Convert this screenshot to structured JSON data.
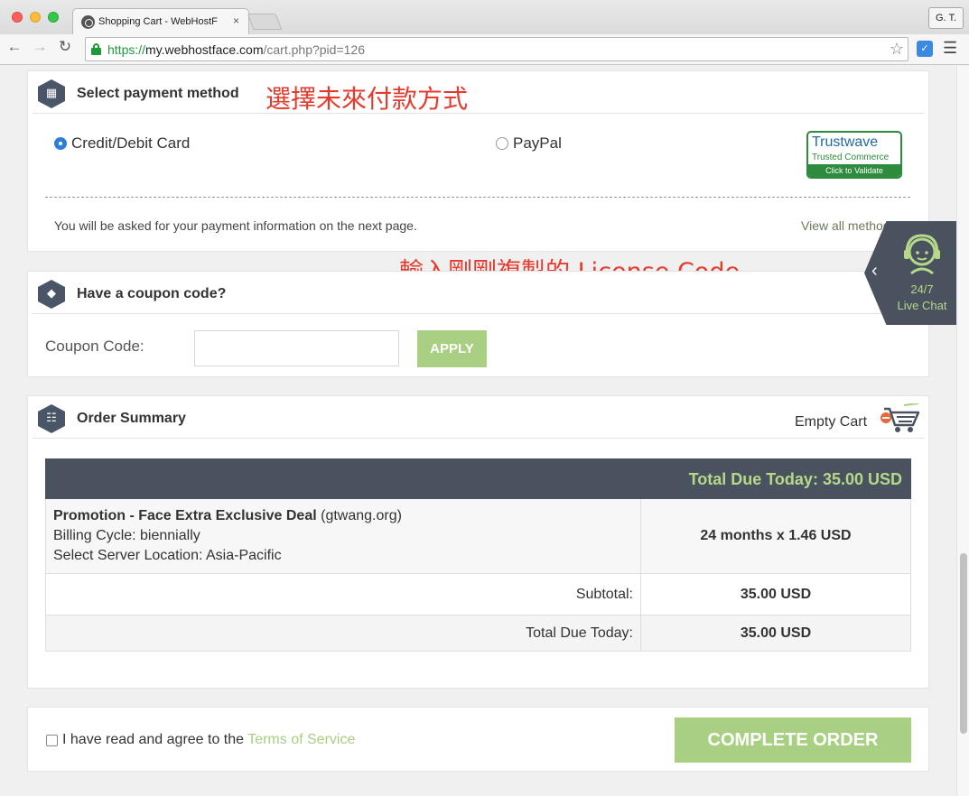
{
  "browser": {
    "tab_title": "Shopping Cart - WebHostF",
    "tab_close": "×",
    "profile": "G. T.",
    "url_scheme": "https://",
    "url_host": "my.webhostface.com",
    "url_path": "/cart.php?pid=126",
    "icons": [
      "back-icon",
      "forward-icon",
      "reload-icon",
      "lock-icon",
      "star-icon",
      "extension-icon",
      "menu-icon"
    ]
  },
  "payment": {
    "title": "Select payment method",
    "annotation": "選擇未來付款方式",
    "options": [
      {
        "label": "Credit/Debit Card",
        "selected": true
      },
      {
        "label": "PayPal",
        "selected": false
      }
    ],
    "badge": {
      "name": "Trustwave",
      "sub": "Trusted Commerce",
      "validate": "Click to Validate"
    },
    "note": "You will be asked for your payment information on the next page.",
    "view_all": "View all method"
  },
  "coupon": {
    "title": "Have a coupon code?",
    "annotation": "輸入剛剛複製的 License Code",
    "label": "Coupon Code:",
    "value": "",
    "apply": "APPLY"
  },
  "order": {
    "title": "Order Summary",
    "empty_cart": "Empty Cart",
    "total_due_header": "Total Due Today: 35.00 USD",
    "item": {
      "name_bold": "Promotion - Face Extra Exclusive Deal",
      "name_suffix": " (gtwang.org)",
      "billing": "Billing Cycle: biennially",
      "location": "Select Server Location: Asia-Pacific",
      "price": "24 months x 1.46 USD"
    },
    "subtotal_label": "Subtotal:",
    "subtotal_value": "35.00 USD",
    "total_label": "Total Due Today:",
    "total_value": "35.00 USD"
  },
  "complete": {
    "tos_prefix": "I have read and agree to the ",
    "tos_link": "Terms of Service",
    "tos_checked": false,
    "button": "COMPLETE ORDER"
  },
  "livechat": {
    "hours": "24/7",
    "label": "Live Chat"
  },
  "colors": {
    "accent_green": "#a8cf82",
    "header_dark": "#4a5260",
    "annotation_red": "#e8392d",
    "selected_radio": "#2f7ed8"
  }
}
